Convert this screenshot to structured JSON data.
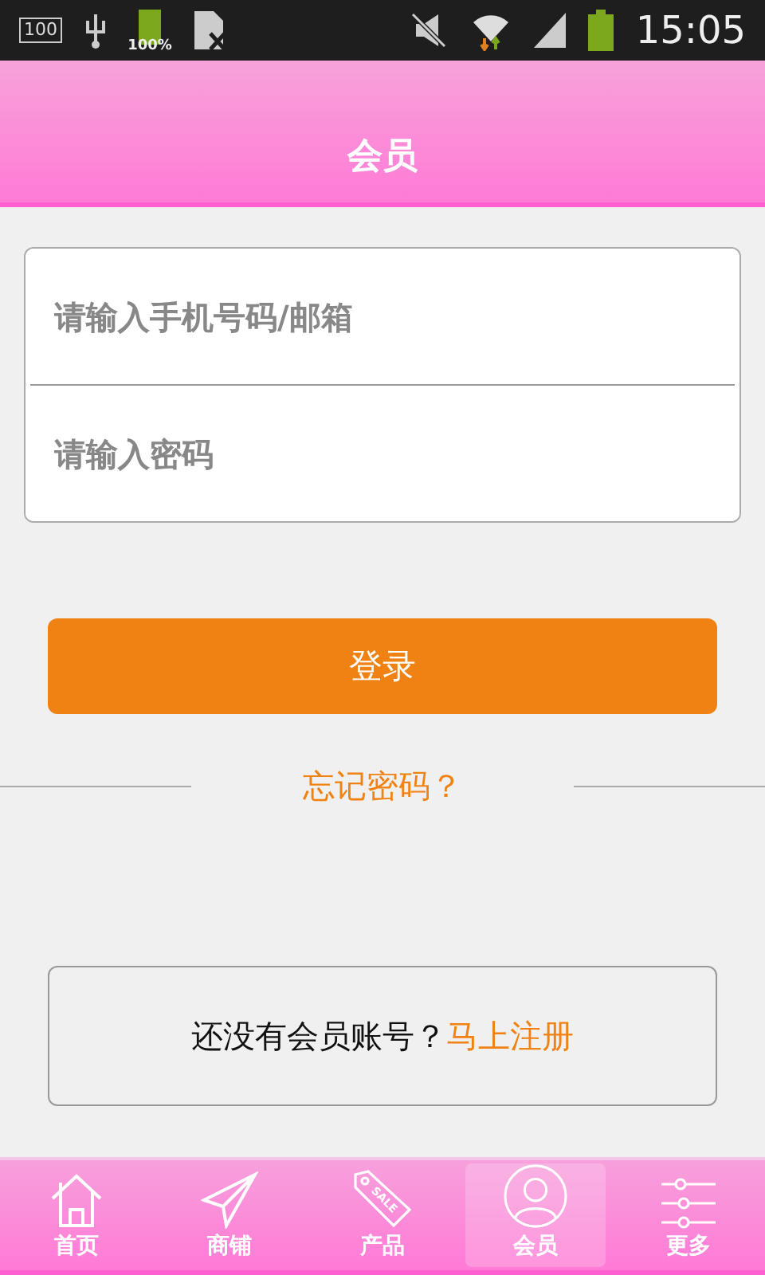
{
  "status_bar": {
    "box_label": "100",
    "battery_label": "100%",
    "time": "15:05"
  },
  "header": {
    "title": "会员"
  },
  "form": {
    "fields": [
      {
        "placeholder": "请输入手机号码/邮箱"
      },
      {
        "placeholder": "请输入密码"
      }
    ]
  },
  "login_button": "登录",
  "forgot_link": "忘记密码？",
  "register": {
    "prompt": "还没有会员账号？",
    "link": "马上注册"
  },
  "nav": [
    {
      "label": "首页",
      "kind": "home",
      "selected": false
    },
    {
      "label": "商铺",
      "kind": "plane",
      "selected": false
    },
    {
      "label": "产品",
      "kind": "tag",
      "selected": false,
      "icon_text": "SALE"
    },
    {
      "label": "会员",
      "kind": "user",
      "selected": true
    },
    {
      "label": "更多",
      "kind": "sliders",
      "selected": false
    }
  ]
}
